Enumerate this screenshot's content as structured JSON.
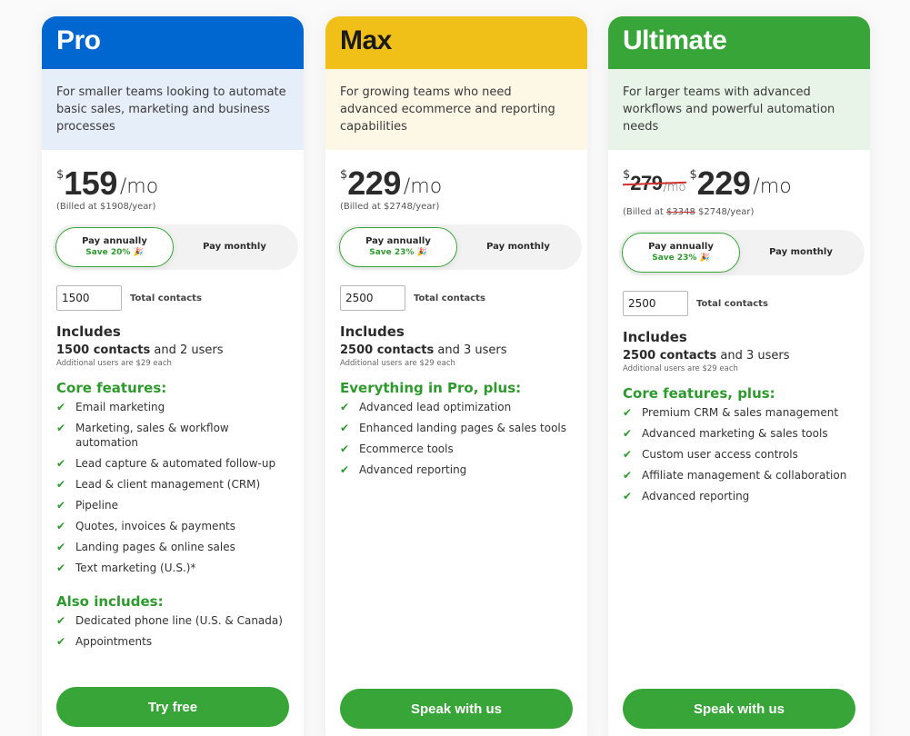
{
  "colors": {
    "pro": "#0066d0",
    "max": "#f0c018",
    "ultimate": "#37a537",
    "accent_green": "#37a537",
    "strike_red": "#d0302a"
  },
  "plans": [
    {
      "name": "Pro",
      "description": "For smaller teams looking to automate basic sales, marketing and business processes",
      "currency": "$",
      "old_price": null,
      "price": "159",
      "period": "/mo",
      "billed_prefix": "(Billed at ",
      "billed_old": null,
      "billed_value": "$1908/year)",
      "toggle": {
        "annual_label": "Pay annually",
        "save_label": "Save 20% 🎉",
        "monthly_label": "Pay monthly"
      },
      "contacts_value": "1500",
      "contacts_label": "Total contacts",
      "includes_title": "Includes",
      "includes_bold": "1500 contacts",
      "includes_rest": " and 2 users",
      "includes_note": "Additional users are $29 each",
      "sections": [
        {
          "title": "Core features:",
          "items": [
            "Email marketing",
            "Marketing, sales & workflow automation",
            "Lead capture & automated follow-up",
            "Lead & client management (CRM)",
            "Pipeline",
            "Quotes, invoices & payments",
            "Landing pages & online sales",
            "Text marketing (U.S.)*"
          ]
        },
        {
          "title": "Also includes:",
          "items": [
            "Dedicated phone line (U.S. & Canada)",
            "Appointments"
          ]
        }
      ],
      "cta": "Try free"
    },
    {
      "name": "Max",
      "description": "For growing teams who need advanced ecommerce and reporting capabilities",
      "currency": "$",
      "old_price": null,
      "price": "229",
      "period": "/mo",
      "billed_prefix": "(Billed at ",
      "billed_old": null,
      "billed_value": "$2748/year)",
      "toggle": {
        "annual_label": "Pay annually",
        "save_label": "Save 23% 🎉",
        "monthly_label": "Pay monthly"
      },
      "contacts_value": "2500",
      "contacts_label": "Total contacts",
      "includes_title": "Includes",
      "includes_bold": "2500 contacts",
      "includes_rest": " and 3 users",
      "includes_note": "Additional users are $29 each",
      "sections": [
        {
          "title": "Everything in Pro, plus:",
          "items": [
            "Advanced lead optimization",
            "Enhanced landing pages & sales tools",
            "Ecommerce tools",
            "Advanced reporting"
          ]
        }
      ],
      "cta": "Speak with us"
    },
    {
      "name": "Ultimate",
      "description": "For larger teams with advanced workflows and powerful automation needs",
      "currency": "$",
      "old_price": "279",
      "old_period": "/mo",
      "price": "229",
      "period": "/mo",
      "billed_prefix": "(Billed at ",
      "billed_old": "$3348",
      "billed_value": " $2748/year)",
      "toggle": {
        "annual_label": "Pay annually",
        "save_label": "Save 23% 🎉",
        "monthly_label": "Pay monthly"
      },
      "contacts_value": "2500",
      "contacts_label": "Total contacts",
      "includes_title": "Includes",
      "includes_bold": "2500 contacts",
      "includes_rest": " and 3 users",
      "includes_note": "Additional users are $29 each",
      "sections": [
        {
          "title": "Core features, plus:",
          "items": [
            "Premium CRM & sales management",
            "Advanced marketing & sales tools",
            "Custom user access controls",
            "Affiliate management & collaboration",
            "Advanced reporting"
          ]
        }
      ],
      "cta": "Speak with us"
    }
  ]
}
